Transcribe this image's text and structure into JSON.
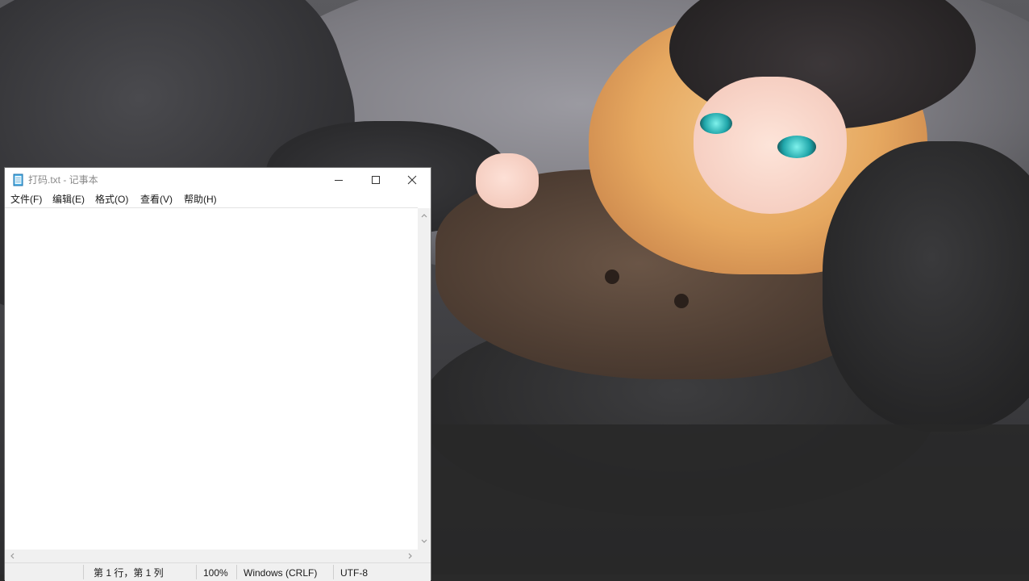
{
  "window": {
    "title": "打码.txt - 记事本",
    "controls": {
      "minimize": "minimize-icon",
      "maximize": "maximize-icon",
      "close": "close-icon"
    }
  },
  "menu": {
    "file": "文件(F)",
    "edit": "编辑(E)",
    "format": "格式(O)",
    "view": "查看(V)",
    "help": "帮助(H)"
  },
  "editor": {
    "content": ""
  },
  "statusbar": {
    "position": "第 1 行，第 1 列",
    "zoom": "100%",
    "line_ending": "Windows (CRLF)",
    "encoding": "UTF-8"
  },
  "colors": {
    "title_text": "#8a8a8a",
    "chrome": "#f0f0f0",
    "editor_bg": "#ffffff",
    "desktop_overlay": "#282828"
  }
}
